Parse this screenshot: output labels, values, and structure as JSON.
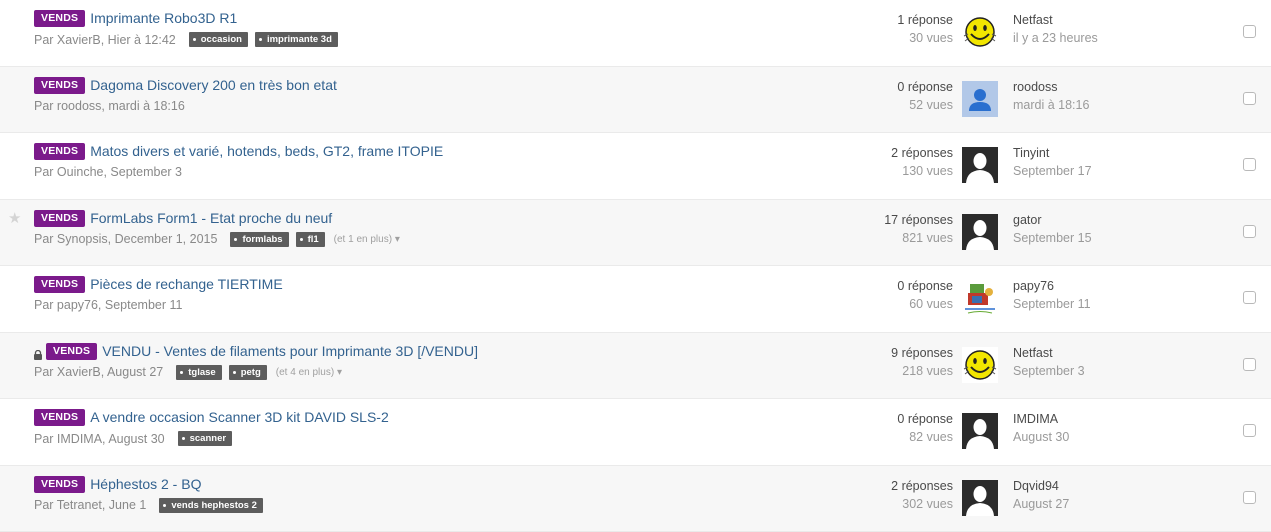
{
  "topics": [
    {
      "badge": "VENDS",
      "title": "Imprimante Robo3D R1",
      "author_line": "Par XavierB, Hier à 12:42",
      "tags": [
        "occasion",
        "imprimante 3d"
      ],
      "more": "",
      "replies": "1 réponse",
      "views": "30 vues",
      "last_user": "Netfast",
      "last_time": "il y a 23 heures",
      "avatar": "smiley-avatar",
      "locked": false,
      "starred": false
    },
    {
      "badge": "VENDS",
      "title": "Dagoma Discovery 200 en très bon etat",
      "author_line": "Par roodoss, mardi à 18:16",
      "tags": [],
      "more": "",
      "replies": "0 réponse",
      "views": "52 vues",
      "last_user": "roodoss",
      "last_time": "mardi à 18:16",
      "avatar": "blue-default-avatar",
      "locked": false,
      "starred": false
    },
    {
      "badge": "VENDS",
      "title": "Matos divers et varié, hotends, beds, GT2, frame ITOPIE",
      "author_line": "Par Ouinche, September 3",
      "tags": [],
      "more": "",
      "replies": "2 réponses",
      "views": "130 vues",
      "last_user": "Tinyint",
      "last_time": "September 17",
      "avatar": "silhouette-avatar",
      "locked": false,
      "starred": false
    },
    {
      "badge": "VENDS",
      "title": "FormLabs Form1 - Etat proche du neuf",
      "author_line": "Par Synopsis, December 1, 2015",
      "tags": [
        "formlabs",
        "fl1"
      ],
      "more": "(et 1 en plus)",
      "replies": "17 réponses",
      "views": "821 vues",
      "last_user": "gator",
      "last_time": "September 15",
      "avatar": "silhouette-avatar",
      "locked": false,
      "starred": true
    },
    {
      "badge": "VENDS",
      "title": "Pièces de rechange TIERTIME",
      "author_line": "Par papy76, September 11",
      "tags": [],
      "more": "",
      "replies": "0 réponse",
      "views": "60 vues",
      "last_user": "papy76",
      "last_time": "September 11",
      "avatar": "cartoon-avatar",
      "locked": false,
      "starred": false
    },
    {
      "badge": "VENDS",
      "title": "VENDU - Ventes de filaments pour Imprimante 3D [/VENDU]",
      "author_line": "Par XavierB, August 27",
      "tags": [
        "tglase",
        "petg"
      ],
      "more": "(et 4 en plus)",
      "replies": "9 réponses",
      "views": "218 vues",
      "last_user": "Netfast",
      "last_time": "September 3",
      "avatar": "smiley-avatar",
      "locked": true,
      "starred": false
    },
    {
      "badge": "VENDS",
      "title": "A vendre occasion Scanner 3D kit DAVID SLS-2",
      "author_line": "Par IMDIMA, August 30",
      "tags": [
        "scanner"
      ],
      "more": "",
      "replies": "0 réponse",
      "views": "82 vues",
      "last_user": "IMDIMA",
      "last_time": "August 30",
      "avatar": "silhouette-avatar",
      "locked": false,
      "starred": false
    },
    {
      "badge": "VENDS",
      "title": "Héphestos 2 - BQ",
      "author_line": "Par Tetranet, June 1",
      "tags": [
        "vends hephestos 2"
      ],
      "more": "",
      "replies": "2 réponses",
      "views": "302 vues",
      "last_user": "Dqvid94",
      "last_time": "August 27",
      "avatar": "silhouette-avatar",
      "locked": false,
      "starred": false
    }
  ],
  "colors": {
    "badge": "#7b1a8b",
    "title_link": "#33628f",
    "tag_bg": "#5d5d5d",
    "alt_row": "#f7f7f7"
  }
}
